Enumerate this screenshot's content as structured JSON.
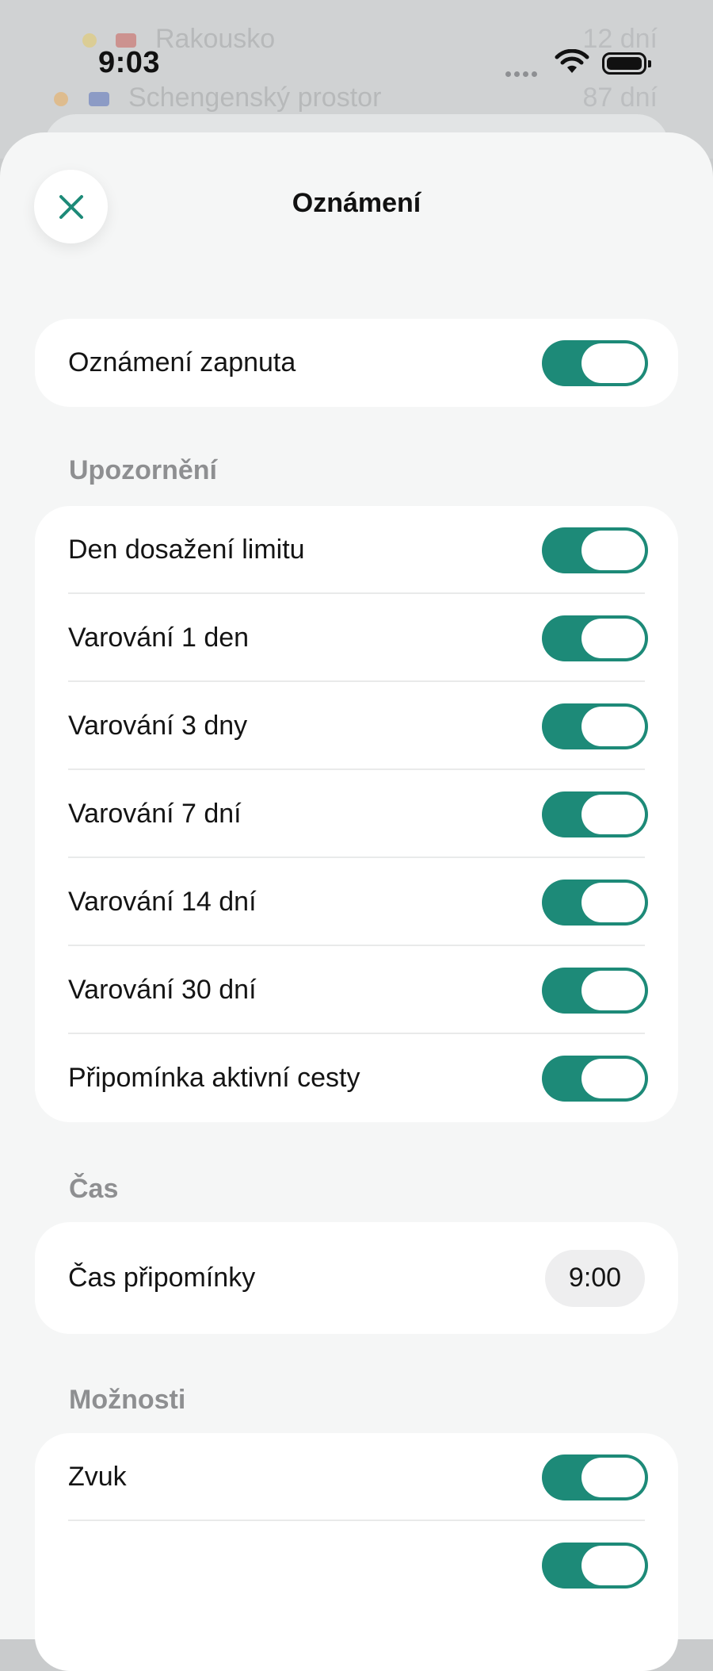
{
  "background": {
    "rows": [
      {
        "text": "Rakousko",
        "value": "12 dní"
      },
      {
        "text": "Schengenský prostor",
        "value": "87 dní"
      }
    ]
  },
  "status_bar": {
    "time": "9:03"
  },
  "sheet": {
    "title": "Oznámení",
    "master_toggle": {
      "label": "Oznámení zapnuta",
      "on": true
    },
    "alerts_section": {
      "header": "Upozornění",
      "items": [
        {
          "label": "Den dosažení limitu",
          "on": true
        },
        {
          "label": "Varování 1 den",
          "on": true
        },
        {
          "label": "Varování 3 dny",
          "on": true
        },
        {
          "label": "Varování 7 dní",
          "on": true
        },
        {
          "label": "Varování 14 dní",
          "on": true
        },
        {
          "label": "Varování 30 dní",
          "on": true
        },
        {
          "label": "Připomínka aktivní cesty",
          "on": true
        }
      ]
    },
    "time_section": {
      "header": "Čas",
      "reminder_label": "Čas připomínky",
      "reminder_value": "9:00"
    },
    "options_section": {
      "header": "Možnosti",
      "items": [
        {
          "label": "Zvuk",
          "on": true
        },
        {
          "label": "",
          "on": true
        }
      ]
    }
  },
  "colors": {
    "accent": "#1d8a78",
    "sheet_bg": "#f5f6f6",
    "card_bg": "#ffffff",
    "section_header": "#8e8f91"
  }
}
